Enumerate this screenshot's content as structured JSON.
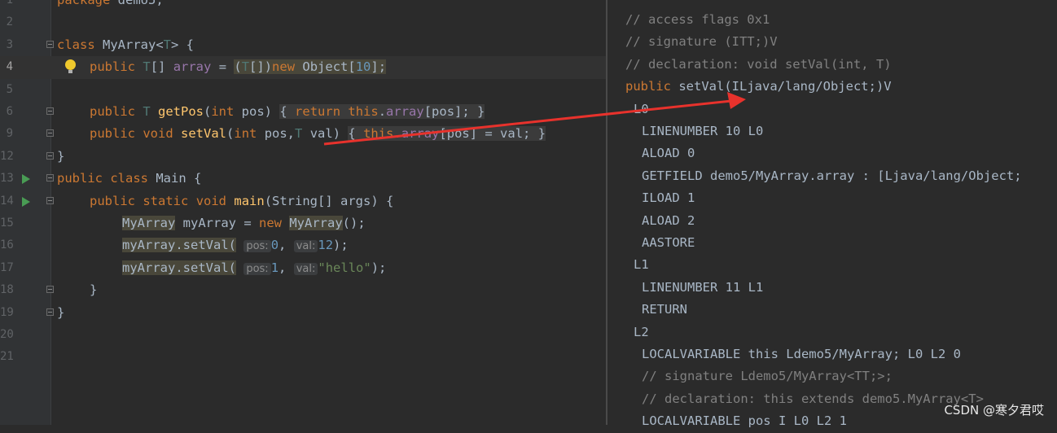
{
  "editor": {
    "lines": [
      {
        "n": "1",
        "text": "package demo5;"
      },
      {
        "n": "2",
        "text": ""
      },
      {
        "n": "3",
        "text": "class MyArray<T> {"
      },
      {
        "n": "4",
        "text": "public T[] array = (T[])new Object[10];"
      },
      {
        "n": "5",
        "text": ""
      },
      {
        "n": "6",
        "text": "public T getPos(int pos) { return this.array[pos]; }"
      },
      {
        "n": "9",
        "text": "public void setVal(int pos,T val) { this.array[pos] = val; }"
      },
      {
        "n": "12",
        "text": "}"
      },
      {
        "n": "13",
        "text": "public class Main {"
      },
      {
        "n": "14",
        "text": "public static void main(String[] args) {"
      },
      {
        "n": "15",
        "text": "MyArray myArray = new MyArray();"
      },
      {
        "n": "16",
        "text": "myArray.setVal( pos: 0, val: 12);"
      },
      {
        "n": "17",
        "text": "myArray.setVal( pos: 1, val: \"hello\");"
      },
      {
        "n": "18",
        "text": "}"
      },
      {
        "n": "19",
        "text": "}"
      },
      {
        "n": "20",
        "text": ""
      },
      {
        "n": "21",
        "text": ""
      }
    ],
    "tokens": {
      "package_kw": "package",
      "package_name": " demo5;",
      "class_kw": "class",
      "myarray_decl": " MyArray<",
      "t1": "T",
      "brace_open": "> {",
      "public": "public",
      "t_array_t": "T",
      "t_array_rest": "[] ",
      "array_field": "array",
      "eq": " = ",
      "cast_open": "(",
      "cast_t": "T",
      "cast_close": "[])",
      "new_kw": "new",
      "object_arr": " Object[",
      "ten": "10",
      "close_bracket_semi": "];",
      "getpos_type": " T ",
      "getpos_name": "getPos",
      "int_kw": "int",
      "pos_param": " pos)",
      "return_kw": "return",
      "this_kw": "this",
      "array_idx": "[pos];",
      "close_fold": " }",
      "void_kw": "void",
      "setval_name": "setVal",
      "pos_comma": " pos,",
      "t_param": "T",
      "val_param": " val)",
      "assign_val": "[pos] = val;",
      "close_brace": "}",
      "main_class": " Main {",
      "static_kw": "static",
      "main_name": "main",
      "string_args": "(String[] args) {",
      "myarray_type": "MyArray",
      "myarray_var": " myArray = ",
      "myarray_ctor": "MyArray",
      "ctor_end": "();",
      "call": "myArray.setVal(",
      "pos_hint": "pos:",
      "val_hint": "val:",
      "zero": "0",
      "one": "1",
      "twelve": "12",
      "hello": "\"hello\"",
      "comma": ",",
      "paren_semi": ");"
    }
  },
  "bytecode": {
    "lines": [
      "// access flags 0x1",
      "// signature (ITT;)V",
      "// declaration: void setVal(int, T)",
      "public setVal(ILjava/lang/Object;)V",
      "L0",
      "LINENUMBER 10 L0",
      "ALOAD 0",
      "GETFIELD demo5/MyArray.array : [Ljava/lang/Object;",
      "ILOAD 1",
      "ALOAD 2",
      "AASTORE",
      "L1",
      "LINENUMBER 11 L1",
      "RETURN",
      "L2",
      "LOCALVARIABLE this Ldemo5/MyArray; L0 L2 0",
      "// signature Ldemo5/MyArray<TT;>;",
      "// declaration: this extends demo5.MyArray<T>",
      "LOCALVARIABLE pos I L0 L2 1"
    ]
  },
  "watermark": "CSDN @寒夕君哎",
  "colors": {
    "arrow": "#e8322c",
    "keyword": "#cc7832",
    "function": "#ffc66d",
    "field": "#9876aa",
    "number": "#6897bb",
    "string": "#6a8759"
  }
}
